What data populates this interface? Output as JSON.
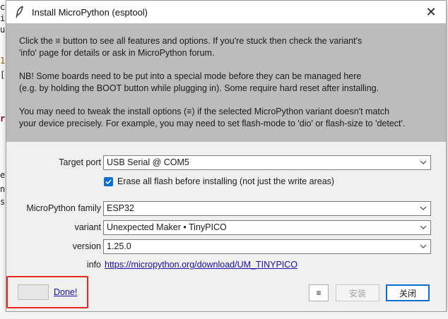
{
  "background_editor": {
    "fragments": [
      "c",
      "i",
      "u",
      "1",
      "[",
      "r",
      "e",
      "n",
      "s"
    ]
  },
  "window": {
    "title": "Install MicroPython (esptool)",
    "close_glyph": "✕"
  },
  "notice": {
    "paragraphs": [
      "Click the ≡ button to see all features and options. If you're stuck then check the variant's\n'info' page for details or ask in MicroPython forum.",
      "NB! Some boards need to be put into a special mode before they can be managed here\n(e.g. by holding the BOOT button while plugging in). Some require hard reset after installing.",
      "You may need to tweak the install options (≡) if the selected MicroPython variant doesn't match\nyour device precisely. For example, you may need to set flash-mode to 'dio' or flash-size to 'detect'."
    ]
  },
  "form": {
    "target_port": {
      "label": "Target port",
      "value": "USB Serial @ COM5"
    },
    "erase_flash": {
      "label": "Erase all flash before installing (not just the write areas)",
      "checked": true
    },
    "family": {
      "label": "MicroPython family",
      "value": "ESP32"
    },
    "variant": {
      "label": "variant",
      "value": "Unexpected Maker • TinyPICO"
    },
    "version": {
      "label": "version",
      "value": "1.25.0"
    },
    "info": {
      "label": "info",
      "url": "https://micropython.org/download/UM_TINYPICO"
    }
  },
  "footer": {
    "status_link": "Done!",
    "menu_button": "≡",
    "install_button": "安装",
    "close_button": "关闭"
  },
  "colors": {
    "accent": "#0b6fcf",
    "highlight": "#e8291f",
    "notice_bg": "#bcbcbc",
    "link": "#1a0dab"
  }
}
